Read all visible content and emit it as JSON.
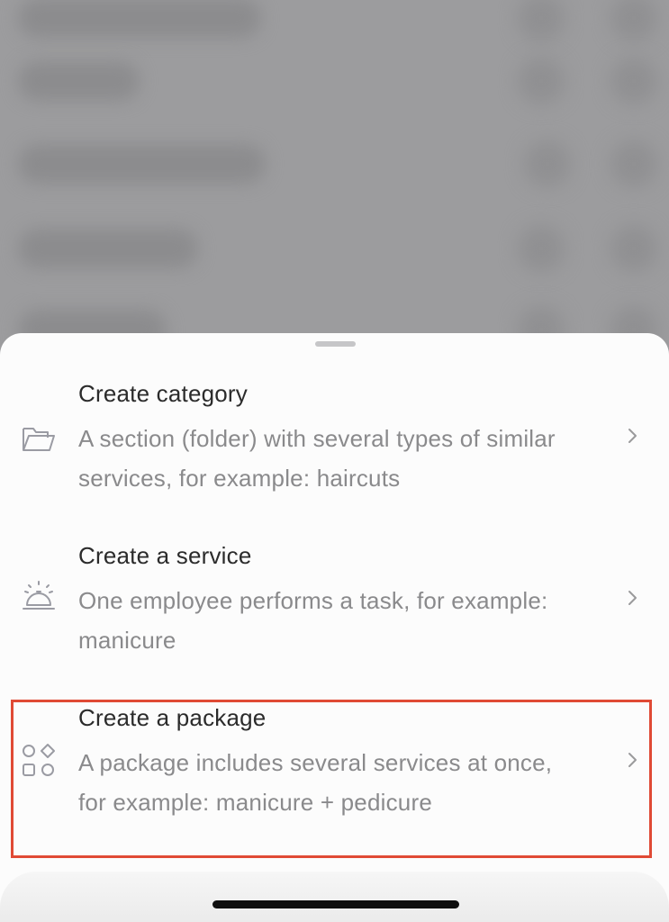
{
  "sheet": {
    "options": [
      {
        "icon": "folder-icon",
        "title": "Create category",
        "description": "A section (folder) with several types of similar services, for example: haircuts",
        "chevron": "chevron-right-icon"
      },
      {
        "icon": "service-bell-icon",
        "title": "Create a service",
        "description": "One employee performs a task, for example: manicure",
        "chevron": "chevron-right-icon"
      },
      {
        "icon": "package-shapes-icon",
        "title": "Create a package",
        "description": "A package includes several services at once, for example: manicure + pedicure",
        "chevron": "chevron-right-icon"
      }
    ],
    "highlighted_option": 2
  },
  "colors": {
    "highlight": "#e04a35",
    "title_text": "#2b2b2b",
    "description_text": "#8a8a8c",
    "overlay": "#9c9c9e"
  }
}
